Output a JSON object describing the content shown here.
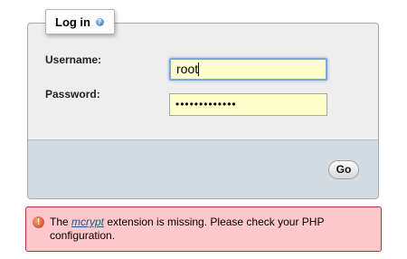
{
  "login": {
    "legend_title": "Log in",
    "help_icon": "help-icon",
    "username_label": "Username:",
    "username_value": "root",
    "password_label": "Password:",
    "password_mask": "•••••••••••••",
    "go_label": "Go"
  },
  "error": {
    "icon": "error-icon",
    "prefix": "The ",
    "link": "mcrypt",
    "suffix": " extension is missing. Please check your PHP configuration."
  },
  "colors": {
    "panel_bg": "#eeeeee",
    "footer_bg": "#d3dce3",
    "input_bg": "#ffffcc",
    "focus_border": "#7ea6d8",
    "error_bg": "#ffc8cc",
    "error_border": "#b33338",
    "link": "#235a81"
  }
}
